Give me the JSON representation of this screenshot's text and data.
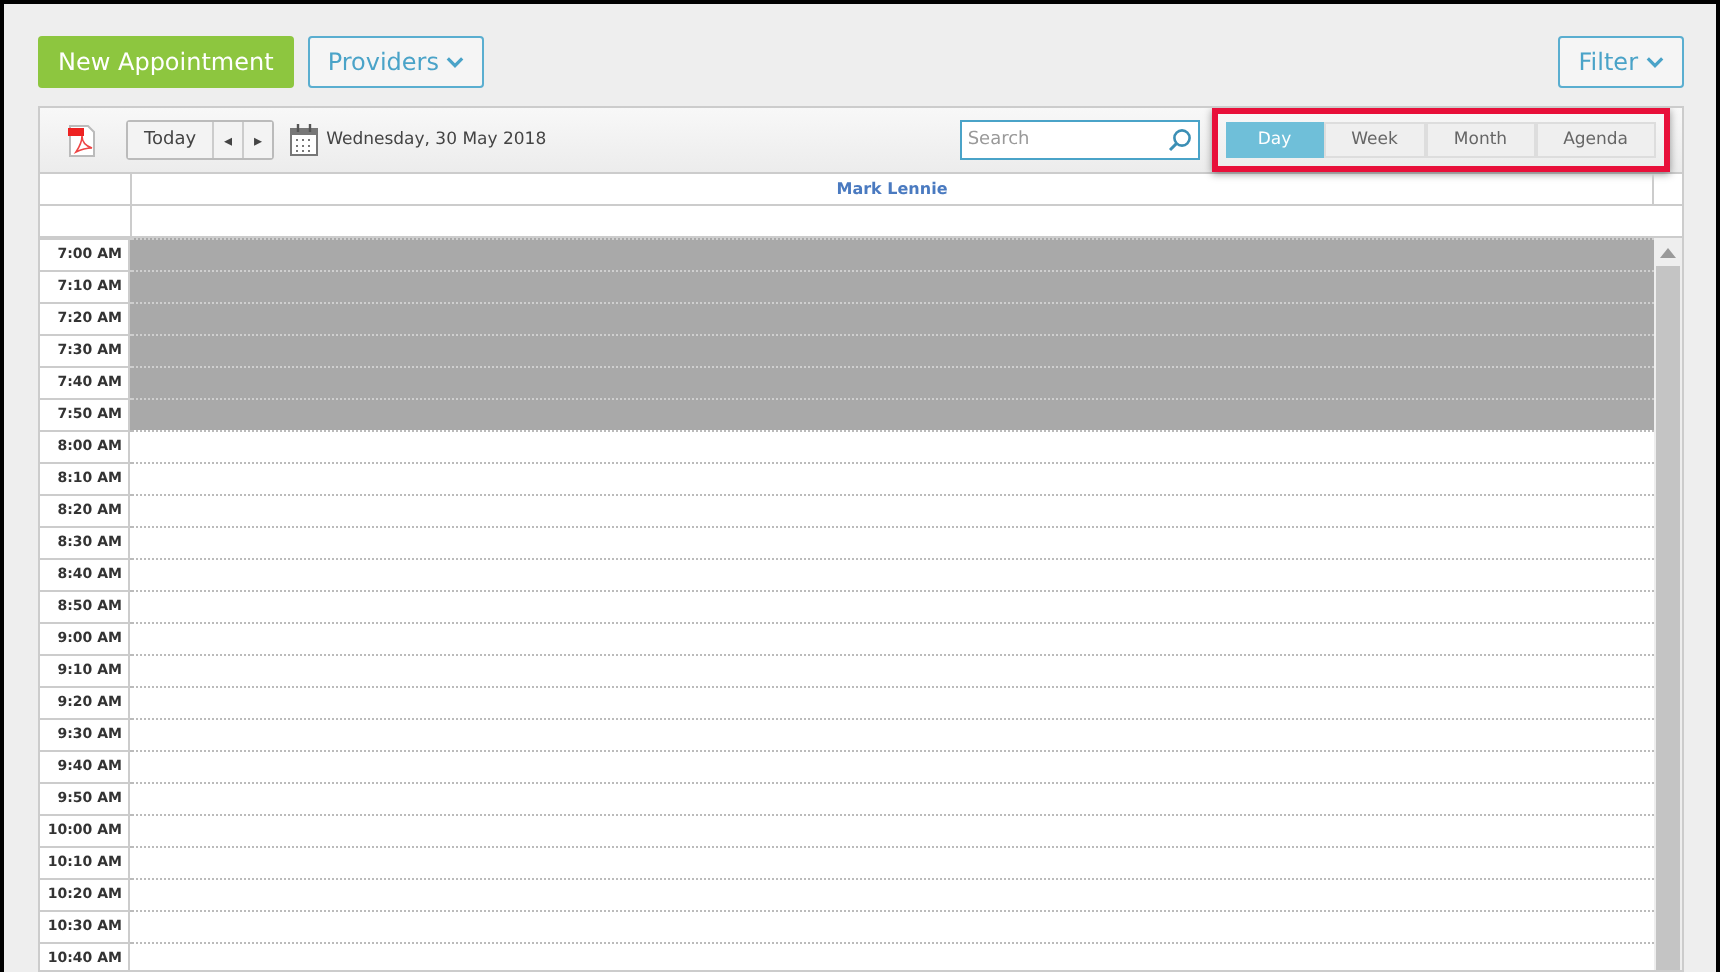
{
  "actions": {
    "new_button": "New Appointment",
    "providers_button": "Providers",
    "filter_button": "Filter"
  },
  "toolbar": {
    "today_button": "Today",
    "prev_button": "◂",
    "next_button": "▸",
    "date": "Wednesday, 30 May 2018",
    "search": {
      "placeholder": "Search"
    },
    "views_highlighted": true,
    "views": [
      {
        "label": "Day",
        "selected": true
      },
      {
        "label": "Week",
        "selected": false
      },
      {
        "label": "Month",
        "selected": false
      },
      {
        "label": "Agenda",
        "selected": false
      }
    ]
  },
  "provider": "Mark Lennie",
  "slots": [
    {
      "time": "7:00 AM",
      "blocked": true
    },
    {
      "time": "7:10 AM",
      "blocked": true
    },
    {
      "time": "7:20 AM",
      "blocked": true
    },
    {
      "time": "7:30 AM",
      "blocked": true
    },
    {
      "time": "7:40 AM",
      "blocked": true
    },
    {
      "time": "7:50 AM",
      "blocked": true
    },
    {
      "time": "8:00 AM",
      "blocked": false
    },
    {
      "time": "8:10 AM",
      "blocked": false
    },
    {
      "time": "8:20 AM",
      "blocked": false
    },
    {
      "time": "8:30 AM",
      "blocked": false
    },
    {
      "time": "8:40 AM",
      "blocked": false
    },
    {
      "time": "8:50 AM",
      "blocked": false
    },
    {
      "time": "9:00 AM",
      "blocked": false
    },
    {
      "time": "9:10 AM",
      "blocked": false
    },
    {
      "time": "9:20 AM",
      "blocked": false
    },
    {
      "time": "9:30 AM",
      "blocked": false
    },
    {
      "time": "9:40 AM",
      "blocked": false
    },
    {
      "time": "9:50 AM",
      "blocked": false
    },
    {
      "time": "10:00 AM",
      "blocked": false
    },
    {
      "time": "10:10 AM",
      "blocked": false
    },
    {
      "time": "10:20 AM",
      "blocked": false
    },
    {
      "time": "10:30 AM",
      "blocked": false
    },
    {
      "time": "10:40 AM",
      "blocked": false
    }
  ]
}
